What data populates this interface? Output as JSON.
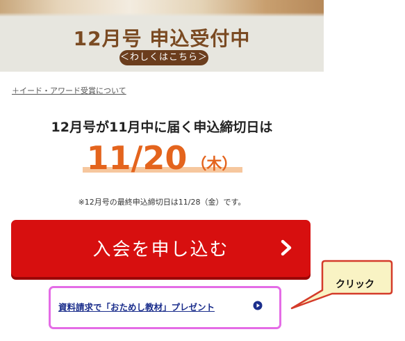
{
  "banner": {
    "title": "12月号 申込受付中",
    "details_label": "＜わしくはこちら＞"
  },
  "award_link": "＋イード・アワード受賞について",
  "deadline": {
    "heading": "12月号が11月中に届く申込締切日は",
    "date": "11/20",
    "weekday": "（木）",
    "note": "※12月号の最終申込締切日は11/28（金）です。"
  },
  "cta": {
    "label": "入会を申し込む",
    "arrow_icon": "chevron-right-icon",
    "color": "#d70f0f"
  },
  "sample": {
    "label": "資料請求で「おためし教材」プレゼント",
    "icon": "play-circle-icon",
    "highlight_color": "#e46ce6"
  },
  "callout": {
    "text": "クリック",
    "color": "#f9f3c4",
    "border_color": "#d43b2a"
  }
}
